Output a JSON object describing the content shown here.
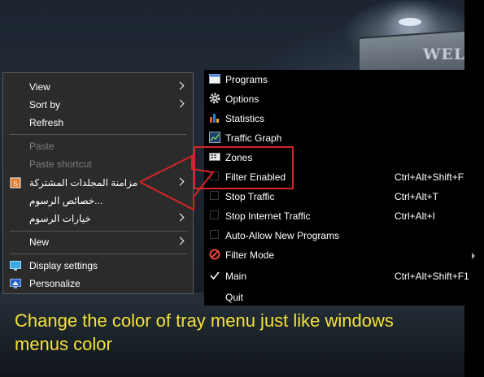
{
  "context_menu": {
    "items": [
      {
        "label": "View",
        "submenu": true
      },
      {
        "label": "Sort by",
        "submenu": true
      },
      {
        "label": "Refresh"
      },
      {
        "label": "Paste",
        "disabled": true
      },
      {
        "label": "Paste shortcut",
        "disabled": true
      },
      {
        "label": "مزامنة المجلدات المشتركة",
        "submenu": true,
        "icon": "sync-folder-icon"
      },
      {
        "label": "خصائص الرسوم..."
      },
      {
        "label": "خيارات الرسوم",
        "submenu": true
      },
      {
        "label": "New",
        "submenu": true
      },
      {
        "label": "Display settings",
        "icon": "display-settings-icon"
      },
      {
        "label": "Personalize",
        "icon": "personalize-icon"
      }
    ]
  },
  "tray_menu": {
    "items": [
      {
        "label": "Programs",
        "icon": "programs-window-icon"
      },
      {
        "label": "Options",
        "icon": "gear-icon"
      },
      {
        "label": "Statistics",
        "icon": "bar-chart-icon"
      },
      {
        "label": "Traffic Graph",
        "icon": "graph-icon"
      },
      {
        "label": "Zones",
        "icon": "zones-icon"
      },
      {
        "label": "Filter Enabled",
        "shortcut": "Ctrl+Alt+Shift+F",
        "checked": false
      },
      {
        "label": "Stop Traffic",
        "shortcut": "Ctrl+Alt+T",
        "checked": false
      },
      {
        "label": "Stop Internet Traffic",
        "shortcut": "Ctrl+Alt+I",
        "checked": false
      },
      {
        "label": "Auto-Allow New Programs",
        "checked": false
      },
      {
        "label": "Filter Mode",
        "icon": "prohibited-icon",
        "submenu": true
      },
      {
        "label": "Main",
        "shortcut": "Ctrl+Alt+Shift+F1",
        "checked": true
      },
      {
        "label": "Quit"
      }
    ]
  },
  "background": {
    "sign_text": "WEL"
  },
  "annotation": {
    "caption": "Change the color of tray menu just like windows menus color",
    "arrow_color": "#d62424",
    "caption_color": "#f4e23a"
  }
}
